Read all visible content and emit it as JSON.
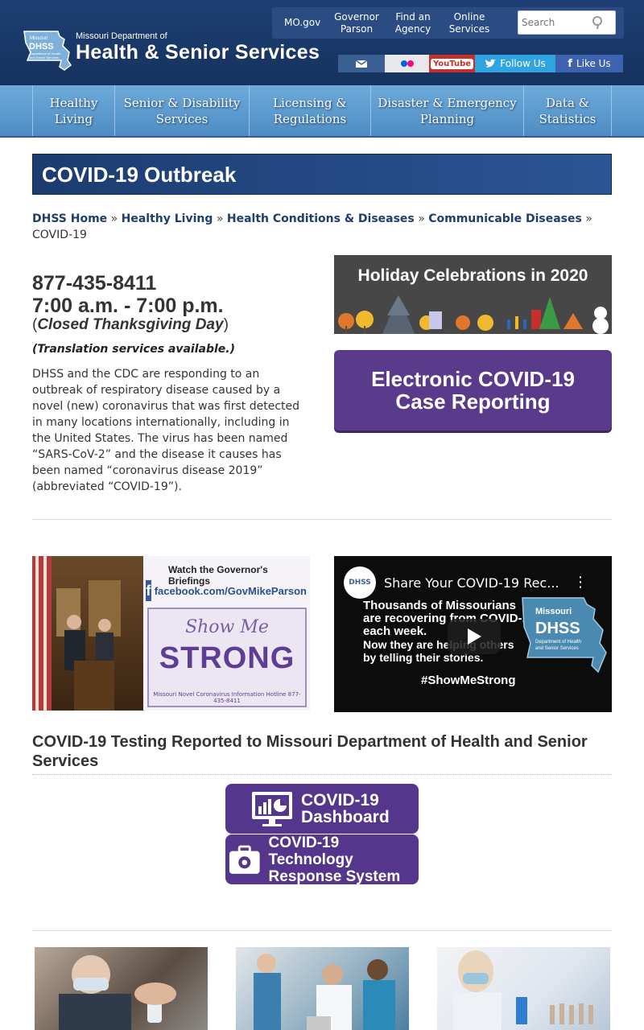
{
  "header": {
    "logo_small": "Missouri Department of",
    "logo_big": "Health & Senior Services",
    "logo_badge": "DHSS",
    "toplinks": {
      "mogov": "MO.gov",
      "governor": "Governor Parson",
      "agency": "Find an Agency",
      "online": "Online Services"
    },
    "search_placeholder": "Search",
    "social": {
      "twitter": "Follow Us",
      "facebook": "Like Us",
      "youtube": "YouTube"
    }
  },
  "nav": [
    {
      "label": "Healthy Living"
    },
    {
      "label": "Senior & Disability Services"
    },
    {
      "label": "Licensing & Regulations"
    },
    {
      "label": "Disaster & Emergency Planning"
    },
    {
      "label": "Data & Statistics"
    }
  ],
  "page_title": "COVID-19 Outbreak",
  "breadcrumb": {
    "items": [
      "DHSS Home",
      "Healthy Living",
      "Health Conditions & Diseases",
      "Communicable Diseases"
    ],
    "current": "COVID-19"
  },
  "hotline": {
    "phone": "877-435-8411",
    "hours": "7:00 a.m. - 7:00 p.m.",
    "closed": "Closed Thanksgiving Day",
    "translation": "(Translation services available.)"
  },
  "intro": "DHSS and the CDC are responding to an outbreak of respiratory disease caused by a novel (new) coronavirus that was first detected in many locations internationally, including in the United States. The virus has been named “SARS-CoV-2” and the disease it causes has been named “coronavirus disease 2019” (abbreviated “COVID-19”).",
  "banners": {
    "holiday": "Holiday Celebrations in 2020",
    "ecr_line1": "Electronic COVID-19",
    "ecr_line2": "Case Reporting"
  },
  "governor_promo": {
    "watch": "Watch the Governor's Briefings",
    "facebook": "facebook.com/GovMikeParson",
    "show_me": "Show Me",
    "strong": "STRONG",
    "hotline": "Missouri Novel Coronavirus Information Hotline  877-435-8411"
  },
  "video": {
    "avatar": "DHSS",
    "title": "Share Your COVID-19 Rec...",
    "line1": "Thousands of Missourians are recovering from COVID-19 each week.",
    "line2": "Now they are helping others by telling their stories.",
    "tag": "#ShowMeStrong",
    "map_missouri": "Missouri",
    "map_dhss": "DHSS",
    "map_dept": "Department of Health and Senior Services"
  },
  "testing": {
    "title": "COVID-19 Testing Reported to Missouri Department of Health and Senior Services",
    "dashboard_l1": "COVID-19",
    "dashboard_l2": "Dashboard",
    "tech_l1": "COVID-19 Technology",
    "tech_l2": "Response System"
  },
  "colors": {
    "header_bg": "#1e3f74",
    "nav_bg": "#6eaad9",
    "button_purple": "#54368d",
    "link": "#1f3d6d"
  }
}
